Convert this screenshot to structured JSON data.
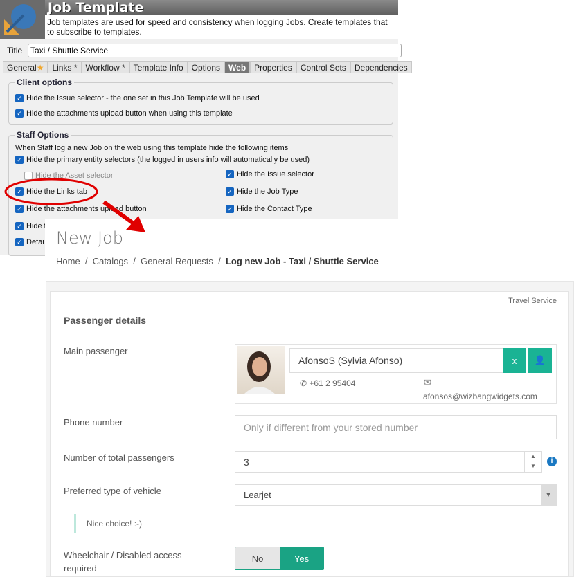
{
  "window": {
    "title": "Job Template",
    "description_line1": "Job templates are used for speed and consistency when logging Jobs.  Create templates that",
    "description_line2": "to subscribe to templates.",
    "title_label": "Title",
    "title_value": "Taxi / Shuttle Service"
  },
  "tabs": [
    {
      "label": "General"
    },
    {
      "label": "Links *"
    },
    {
      "label": "Workflow *"
    },
    {
      "label": "Template Info"
    },
    {
      "label": "Options"
    },
    {
      "label": "Web",
      "active": true
    },
    {
      "label": "Properties"
    },
    {
      "label": "Control Sets"
    },
    {
      "label": "Dependencies"
    }
  ],
  "client_options": {
    "legend": "Client options",
    "items": [
      {
        "label": "Hide the Issue selector - the one set in this Job Template will be used",
        "checked": true
      },
      {
        "label": "Hide the attachments upload button when using this template",
        "checked": true
      }
    ]
  },
  "staff_options": {
    "legend": "Staff Options",
    "intro": "When Staff log a new Job on the web using this template hide the following items",
    "items": [
      {
        "label": "Hide the primary entity selectors (the logged in users info will automatically be used)",
        "checked": true
      },
      {
        "label": "Hide the Asset selector",
        "checked": false,
        "disabled": true
      },
      {
        "label": "Hide the Issue selector",
        "checked": true
      },
      {
        "label": "Hide the Links tab",
        "checked": true
      },
      {
        "label": "Hide the Job Type",
        "checked": true
      },
      {
        "label": "Hide the attachments upload button",
        "checked": true
      },
      {
        "label": "Hide the Contact Type",
        "checked": true
      },
      {
        "label": "Hide t",
        "checked": true
      },
      {
        "label": "Defau",
        "checked": true
      }
    ]
  },
  "new_job": {
    "title": "New Job",
    "breadcrumb": [
      "Home",
      "Catalogs",
      "General Requests"
    ],
    "breadcrumb_current": "Log new Job - Taxi / Shuttle Service",
    "badge": "Travel Service",
    "section": "Passenger details",
    "main_passenger_label": "Main passenger",
    "passenger_name": "AfonsoS (Sylvia Afonso)",
    "clear_label": "x",
    "phone": "+61 2 95404",
    "email": "afonsos@wizbangwidgets.com",
    "phone_label": "Phone number",
    "phone_placeholder": "Only if different from your stored number",
    "passengers_label": "Number of total passengers",
    "passengers_value": "3",
    "vehicle_label": "Preferred type of vehicle",
    "vehicle_value": "Learjet",
    "note": "Nice choice! :-)",
    "wheelchair_label_1": "Wheelchair / Disabled access",
    "wheelchair_label_2": "required",
    "no_label": "No",
    "yes_label": "Yes",
    "wheelchair_value": "Yes"
  },
  "colors": {
    "accent": "#1ab394",
    "checkbox": "#1565c0",
    "annotation": "#e00000"
  }
}
